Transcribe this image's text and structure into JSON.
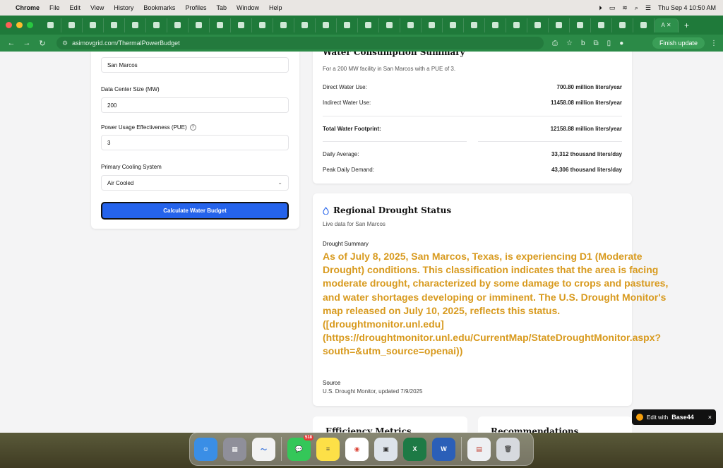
{
  "menubar": {
    "app": "Chrome",
    "items": [
      "File",
      "Edit",
      "View",
      "History",
      "Bookmarks",
      "Profiles",
      "Tab",
      "Window",
      "Help"
    ],
    "clock": "Thu Sep 4  10:50 AM"
  },
  "browser": {
    "url_host": "asimovgrid.com",
    "url_path": "/ThermalPowerBudget",
    "finish_update": "Finish update",
    "active_tab_label": "A"
  },
  "form": {
    "location_value": "San Marcos",
    "size_label": "Data Center Size (MW)",
    "size_value": "200",
    "pue_label": "Power Usage Effectiveness (PUE)",
    "pue_value": "3",
    "cooling_label": "Primary Cooling System",
    "cooling_value": "Air Cooled",
    "calculate_label": "Calculate Water Budget"
  },
  "water_summary": {
    "title": "Water Consumption Summary",
    "subtitle": "For a 200 MW facility in San Marcos with a PUE of 3.",
    "direct_label": "Direct Water Use:",
    "direct_value": "700.80 million liters/year",
    "indirect_label": "Indirect Water Use:",
    "indirect_value": "11458.08 million liters/year",
    "total_label": "Total Water Footprint:",
    "total_value": "12158.88 million liters/year",
    "daily_label": "Daily Average:",
    "daily_value": "33,312 thousand liters/day",
    "peak_label": "Peak Daily Demand:",
    "peak_value": "43,306 thousand liters/day"
  },
  "drought": {
    "title": "Regional Drought Status",
    "subtitle": "Live data for San Marcos",
    "summary_heading": "Drought Summary",
    "summary_text": "As of July 8, 2025, San Marcos, Texas, is experiencing D1 (Moderate Drought) conditions. This classification indicates that the area is facing moderate drought, characterized by some damage to crops and pastures, and water shortages developing or imminent. The U.S. Drought Monitor's map released on July 10, 2025, reflects this status. ([droughtmonitor.unl.edu](https://droughtmonitor.unl.edu/CurrentMap/StateDroughtMonitor.aspx?south=&utm_source=openai))",
    "source_heading": "Source",
    "source_text": "U.S. Drought Monitor, updated 7/9/2025"
  },
  "bottom": {
    "efficiency_title": "Efficiency Metrics",
    "recommendations_title": "Recommendations"
  },
  "edit_badge": {
    "prefix": "Edit with",
    "brand": "Base44",
    "close": "×"
  },
  "dock": {
    "messages_badge": "518"
  },
  "colors": {
    "button_blue": "#2563eb",
    "summary_amber": "#d89a1e",
    "tab_green": "#1f7a3a"
  }
}
